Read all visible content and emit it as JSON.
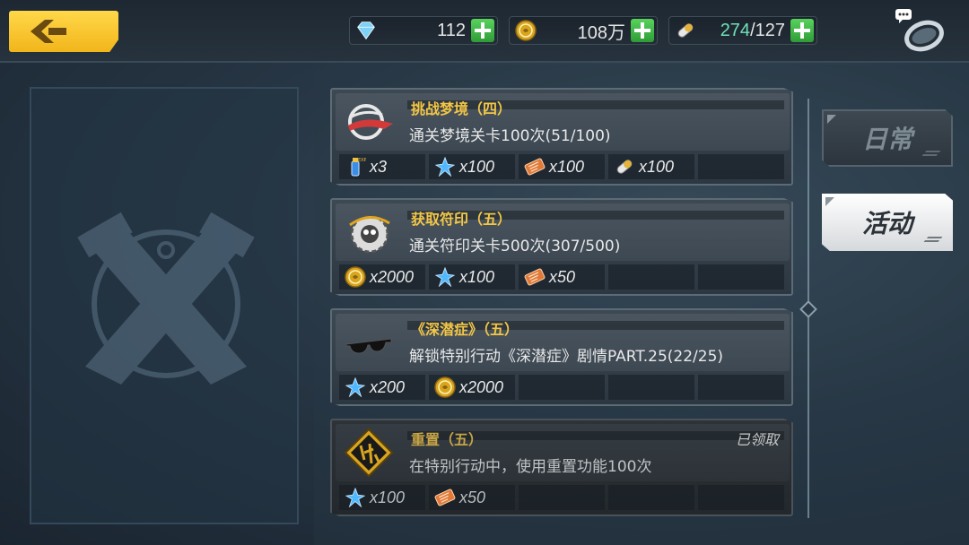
{
  "resources": {
    "gems": "112",
    "coins": "108万",
    "stamina_current": "274",
    "stamina_sep_max": "/127"
  },
  "tabs": {
    "daily": "日常",
    "event": "活动"
  },
  "missions": [
    {
      "title": "挑战梦境（四）",
      "desc": "通关梦境关卡100次(51/100)",
      "icon": "dream-emblem-icon",
      "rewards": [
        {
          "icon": "exp-potion-icon",
          "qty": "x3"
        },
        {
          "icon": "blue-crystal-icon",
          "qty": "x100"
        },
        {
          "icon": "ticket-icon",
          "qty": "x100"
        },
        {
          "icon": "stamina-capsule-icon",
          "qty": "x100"
        }
      ]
    },
    {
      "title": "获取符印（五）",
      "desc": "通关符印关卡500次(307/500)",
      "icon": "gear-sigil-icon",
      "rewards": [
        {
          "icon": "gold-coin-icon",
          "qty": "x2000"
        },
        {
          "icon": "blue-crystal-icon",
          "qty": "x100"
        },
        {
          "icon": "ticket-icon",
          "qty": "x50"
        }
      ]
    },
    {
      "title": "《深潜症》（五）",
      "desc": "解锁特别行动《深潜症》剧情PART.25(22/25)",
      "icon": "sunglasses-icon",
      "rewards": [
        {
          "icon": "blue-crystal-icon",
          "qty": "x200"
        },
        {
          "icon": "gold-coin-icon",
          "qty": "x2000"
        }
      ]
    },
    {
      "title": "重置（五）",
      "desc": "在特别行动中，使用重置功能100次",
      "status": "已领取",
      "icon": "reset-rune-icon",
      "rewards": [
        {
          "icon": "blue-crystal-icon",
          "qty": "x100"
        },
        {
          "icon": "ticket-icon",
          "qty": "x50"
        }
      ]
    }
  ],
  "colors": {
    "accent_gold": "#f3c646",
    "button_yellow": "#f2b51a",
    "plus_green": "#3fb648",
    "stamina_green": "#6fe3b5"
  }
}
